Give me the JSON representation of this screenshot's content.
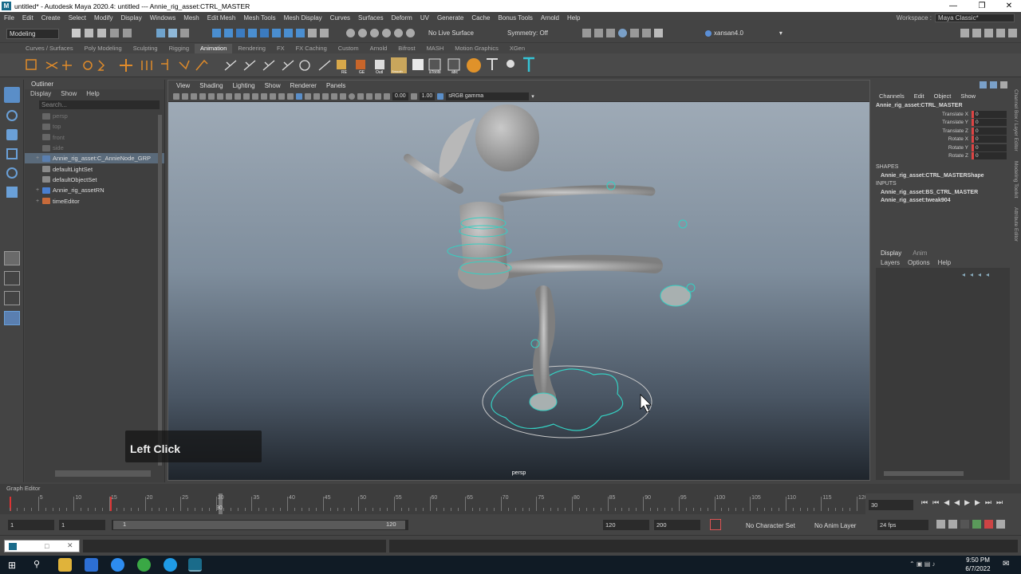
{
  "window": {
    "title": "untitled* - Autodesk Maya 2020.4: untitled   ---   Annie_rig_asset:CTRL_MASTER",
    "icon_letter": "M"
  },
  "menubar": {
    "items": [
      "File",
      "Edit",
      "Create",
      "Select",
      "Modify",
      "Display",
      "Windows",
      "Mesh",
      "Edit Mesh",
      "Mesh Tools",
      "Mesh Display",
      "Curves",
      "Surfaces",
      "Deform",
      "UV",
      "Generate",
      "Cache",
      "Bonus Tools",
      "Arnold",
      "Help"
    ],
    "workspace_label": "Workspace :",
    "workspace_value": "Maya Classic*"
  },
  "statusline": {
    "menuset": "Modeling",
    "live_surface": "No Live Surface",
    "symmetry": "Symmetry: Off",
    "user": "xansan4.0"
  },
  "shelf": {
    "tabs": [
      "Curves / Surfaces",
      "Poly Modeling",
      "Sculpting",
      "Rigging",
      "Animation",
      "Rendering",
      "FX",
      "FX Caching",
      "Custom",
      "Arnold",
      "Bifrost",
      "MASH",
      "Motion Graphics",
      "XGen"
    ],
    "active_tab": "Animation",
    "icon_labels": [
      "RE",
      "GE",
      "Outl",
      "Smooth",
      "aTools",
      "abc"
    ]
  },
  "outliner": {
    "title": "Outliner",
    "menu": [
      "Display",
      "Show",
      "Help"
    ],
    "search_placeholder": "Search...",
    "items": [
      {
        "label": "persp",
        "dim": true,
        "exp": ""
      },
      {
        "label": "top",
        "dim": true,
        "exp": ""
      },
      {
        "label": "front",
        "dim": true,
        "exp": ""
      },
      {
        "label": "side",
        "dim": true,
        "exp": ""
      },
      {
        "label": "Annie_rig_asset:C_AnnieNode_GRP",
        "dim": false,
        "exp": "+",
        "sel": true
      },
      {
        "label": "defaultLightSet",
        "dim": false,
        "exp": ""
      },
      {
        "label": "defaultObjectSet",
        "dim": false,
        "exp": ""
      },
      {
        "label": "Annie_rig_assetRN",
        "dim": false,
        "exp": "+"
      },
      {
        "label": "timeEditor",
        "dim": false,
        "exp": "+"
      }
    ]
  },
  "viewport": {
    "menu": [
      "View",
      "Shading",
      "Lighting",
      "Show",
      "Renderer",
      "Panels"
    ],
    "field1": "0.00",
    "field2": "1.00",
    "colorspace": "sRGB gamma",
    "camera": "persp"
  },
  "overlay": {
    "text": "Left Click"
  },
  "channelbox": {
    "menu": [
      "Channels",
      "Edit",
      "Object",
      "Show"
    ],
    "node": "Annie_rig_asset:CTRL_MASTER",
    "attrs": [
      {
        "name": "Translate X",
        "value": "0"
      },
      {
        "name": "Translate Y",
        "value": "0"
      },
      {
        "name": "Translate Z",
        "value": "0"
      },
      {
        "name": "Rotate X",
        "value": "0"
      },
      {
        "name": "Rotate Y",
        "value": "0"
      },
      {
        "name": "Rotate Z",
        "value": "0"
      }
    ],
    "shapes_label": "SHAPES",
    "shape": "Annie_rig_asset:CTRL_MASTERShape",
    "inputs_label": "INPUTS",
    "inputs": [
      "Annie_rig_asset:BS_CTRL_MASTER",
      "Annie_rig_asset:tweak904"
    ]
  },
  "layer_editor": {
    "tabs": [
      "Display",
      "Anim"
    ],
    "menu": [
      "Layers",
      "Options",
      "Help"
    ]
  },
  "side_tabs": [
    "Channel Box / Layer Editor",
    "Modeling Toolkit",
    "Attribute Editor"
  ],
  "graph_editor_label": "Graph Editor",
  "timeline": {
    "labels": [
      "5",
      "10",
      "15",
      "20",
      "25",
      "30",
      "35",
      "40",
      "45",
      "50",
      "55",
      "60",
      "65",
      "70",
      "75",
      "80",
      "85",
      "90",
      "95",
      "100",
      "105",
      "110",
      "115",
      "120"
    ],
    "current_frame": "30",
    "current_field": "30",
    "ticks_start": 1,
    "ticks_end": 120
  },
  "range": {
    "start": "1",
    "anim_start": "1",
    "slider_start": "1",
    "slider_end": "120",
    "end": "120",
    "anim_end": "200",
    "char_set": "No Character Set",
    "anim_layer": "No Anim Layer",
    "fps": "24 fps"
  },
  "taskbar": {
    "time": "9:50 PM",
    "date": "6/7/2022"
  }
}
